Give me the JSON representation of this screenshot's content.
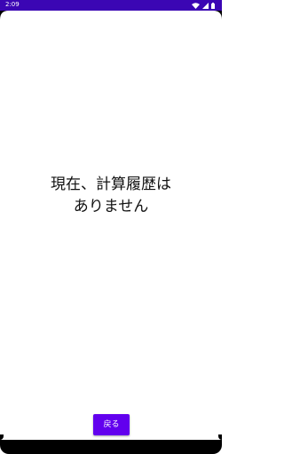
{
  "status_bar": {
    "time": "2:09",
    "icons": [
      "wifi-icon",
      "signal-icon",
      "battery-icon"
    ],
    "background": "#3b06b4"
  },
  "main": {
    "empty_line1": "現在、計算履歴は",
    "empty_line2": "ありません"
  },
  "footer": {
    "back_label": "戻る",
    "button_color": "#6200ee"
  }
}
